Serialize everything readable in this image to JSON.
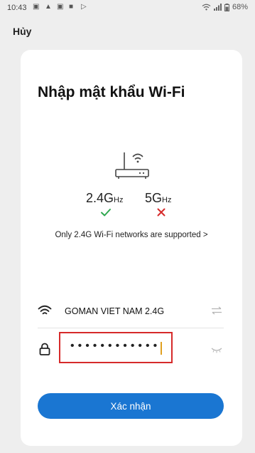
{
  "status_bar": {
    "time": "10:43",
    "battery": "68%"
  },
  "header": {
    "cancel_label": "Hủy"
  },
  "card": {
    "title": "Nhập mật khẩu Wi-Fi",
    "band_24": {
      "main": "2.4G",
      "unit": "Hz",
      "supported": true
    },
    "band_5": {
      "main": "5G",
      "unit": "Hz",
      "supported": false
    },
    "support_note": "Only 2.4G Wi-Fi networks are supported",
    "support_chevron": ">",
    "ssid": "GOMAN VIET NAM 2.4G",
    "password_masked": "•••••••••••••••",
    "confirm_label": "Xác nhận"
  },
  "colors": {
    "accent": "#1a76d2",
    "ok": "#2fa84f",
    "error": "#d62a2a",
    "highlight_border": "#d62a2a"
  },
  "icons": {
    "router": "router-icon",
    "wifi": "wifi-icon",
    "lock": "lock-icon",
    "swap": "swap-icon",
    "eye": "eye-icon",
    "check": "check-icon",
    "cross": "cross-icon"
  }
}
